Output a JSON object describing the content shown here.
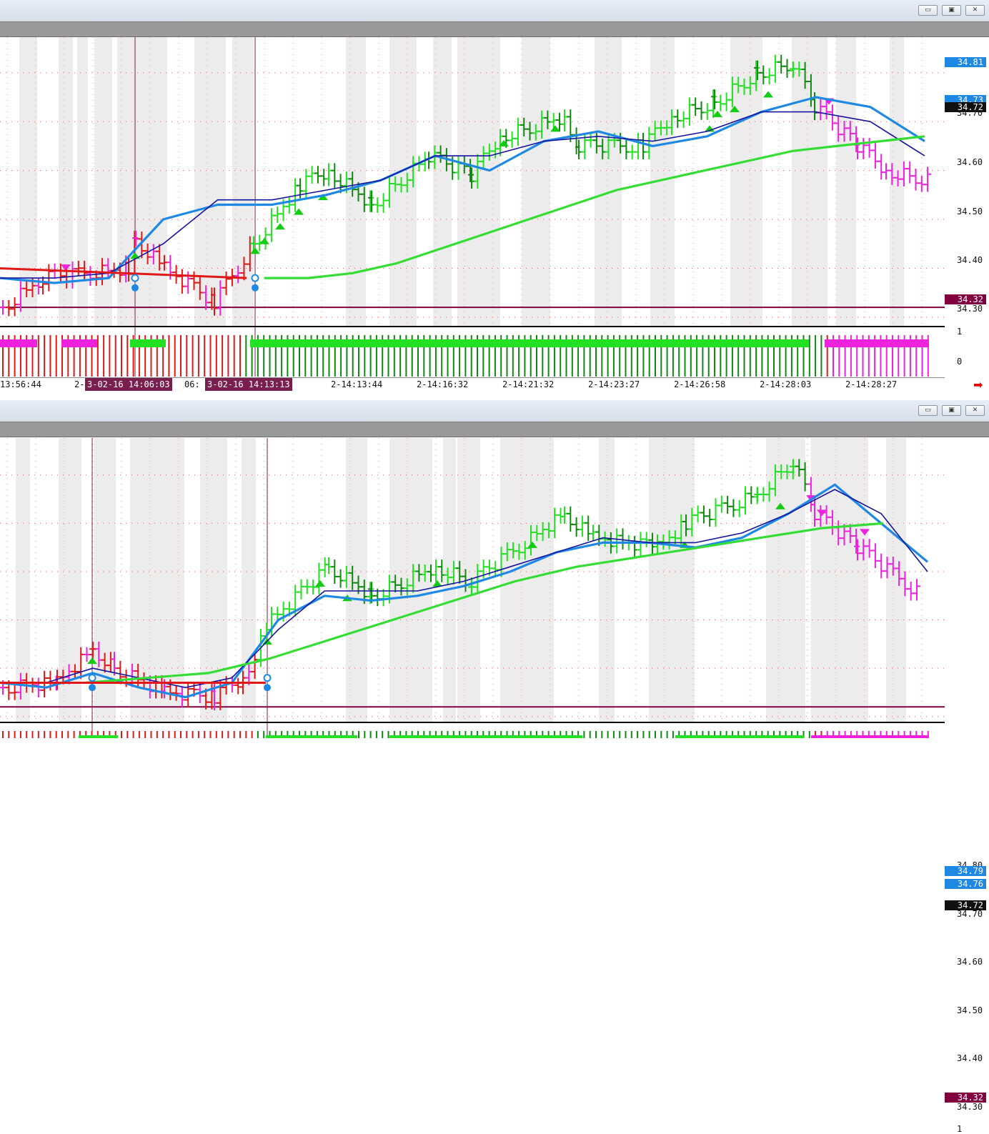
{
  "colors": {
    "up": "#22e022",
    "up_dark": "#118811",
    "down": "#e01818",
    "magenta": "#ee22dd",
    "blue": "#1e88e5",
    "navy": "#1414a0",
    "ma": "#33dd33",
    "support": "#800040"
  },
  "window_controls": {
    "minimize": "▭",
    "maximize": "▣",
    "close": "✕"
  },
  "top": {
    "price_ticks": [
      "34.70",
      "34.60",
      "34.50",
      "34.40",
      "34.30"
    ],
    "badges": [
      {
        "label": "34.81",
        "color": "#1e88e5"
      },
      {
        "label": "34.73",
        "color": "#1e88e5"
      },
      {
        "label": "34.72",
        "color": "#111111"
      },
      {
        "label": "34.32",
        "color": "#800040"
      }
    ],
    "osc_ticks": [
      "1",
      "0"
    ],
    "time_labels": [
      "13:56:44",
      "2-",
      "06:",
      "2-14:13:44",
      "2-14:16:32",
      "2-14:21:32",
      "2-14:23:27",
      "2-14:26:58",
      "2-14:28:03",
      "2-14:28:27"
    ],
    "cursor_labels": [
      "3-02-16  14:06:03",
      "3-02-16  14:13:13"
    ]
  },
  "bottom": {
    "price_ticks": [
      "34.80",
      "34.70",
      "34.60",
      "34.50",
      "34.40",
      "34.30"
    ],
    "badges": [
      {
        "label": "34.79",
        "color": "#1e88e5"
      },
      {
        "label": "34.76",
        "color": "#1e88e5"
      },
      {
        "label": "34.72",
        "color": "#111111"
      },
      {
        "label": "34.32",
        "color": "#800040"
      }
    ],
    "osc_ticks": [
      "1"
    ]
  },
  "chart_data": [
    {
      "type": "line",
      "series": [
        {
          "values": [
            34.38,
            34.37,
            34.38,
            34.5,
            34.53,
            34.53,
            34.55,
            34.58,
            34.63,
            34.6,
            34.66,
            34.68,
            34.65,
            34.67,
            34.72,
            34.75,
            34.73,
            34.66
          ]
        },
        {
          "values": [
            34.38,
            34.38,
            34.39,
            34.45,
            34.54,
            34.54,
            34.56,
            34.58,
            34.63,
            34.63,
            34.66,
            34.67,
            34.66,
            34.68,
            34.72,
            34.72,
            34.7,
            34.63
          ]
        },
        {
          "values": [
            34.38,
            34.38,
            34.39,
            34.41,
            34.44,
            34.47,
            34.5,
            34.53,
            34.56,
            34.58,
            34.6,
            34.62,
            34.64,
            34.65,
            34.66,
            34.67
          ]
        }
      ]
    },
    {
      "type": "line",
      "series": [
        {
          "values": [
            34.37,
            34.36,
            34.39,
            34.36,
            34.34,
            34.37,
            34.5,
            34.55,
            34.54,
            34.55,
            34.57,
            34.6,
            34.64,
            34.66,
            34.66,
            34.65,
            34.67,
            34.72,
            34.78,
            34.7,
            34.62
          ]
        },
        {
          "values": [
            34.37,
            34.37,
            34.4,
            34.38,
            34.36,
            34.38,
            34.48,
            34.56,
            34.56,
            34.56,
            34.58,
            34.61,
            34.64,
            34.67,
            34.66,
            34.66,
            34.68,
            34.72,
            34.77,
            34.72,
            34.6
          ]
        },
        {
          "values": [
            34.37,
            34.38,
            34.39,
            34.42,
            34.46,
            34.5,
            34.54,
            34.58,
            34.61,
            34.63,
            34.65,
            34.67,
            34.69,
            34.7
          ]
        }
      ]
    }
  ]
}
